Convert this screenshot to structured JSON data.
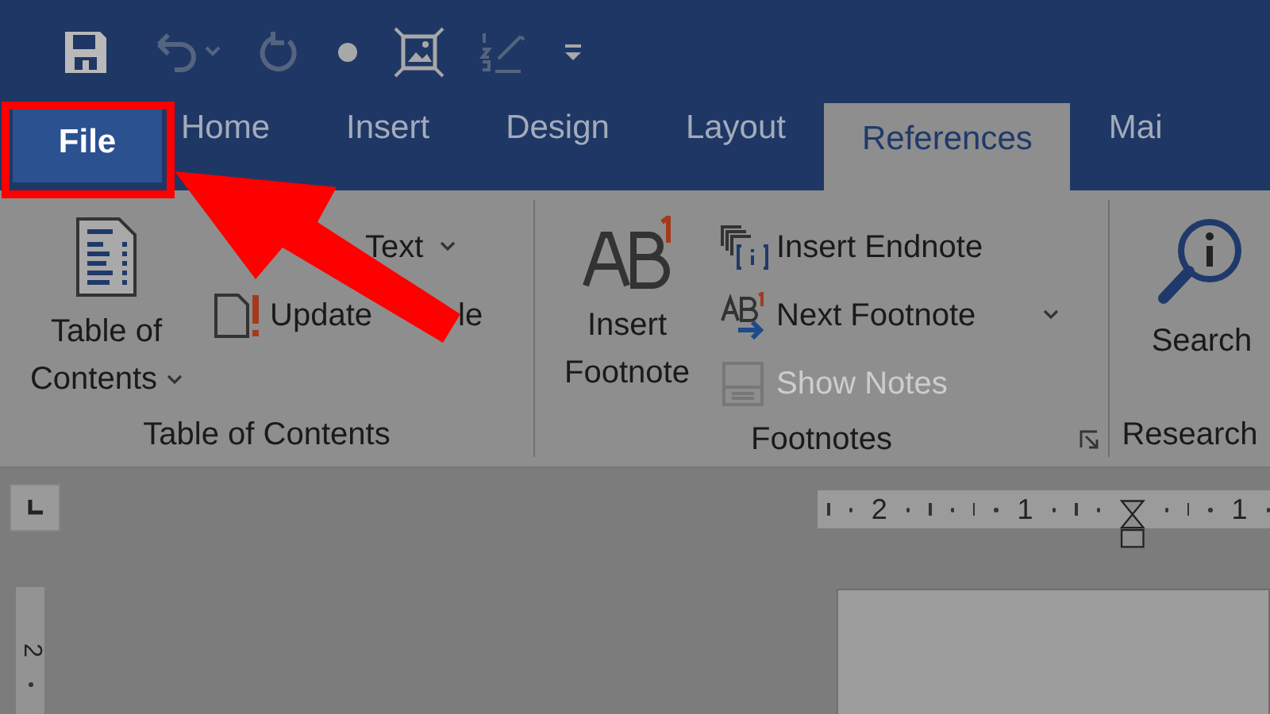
{
  "tabs": [
    {
      "label": "File",
      "selected": false,
      "kind": "backstage"
    },
    {
      "label": "Home",
      "selected": false,
      "kind": "tab"
    },
    {
      "label": "Insert",
      "selected": false,
      "kind": "tab"
    },
    {
      "label": "Design",
      "selected": false,
      "kind": "tab"
    },
    {
      "label": "Layout",
      "selected": false,
      "kind": "tab"
    },
    {
      "label": "References",
      "selected": true,
      "kind": "tab"
    },
    {
      "label": "Mai",
      "selected": false,
      "kind": "tab"
    }
  ],
  "ribbon": {
    "groups": [
      {
        "label": "Table of Contents",
        "launcher": false,
        "items": [
          {
            "kind": "large",
            "label": "Table of Contents",
            "dropdown": true,
            "disabled": false
          },
          {
            "kind": "small",
            "label": "Text",
            "dropdown": true,
            "disabled": false
          },
          {
            "kind": "small",
            "label": "Update",
            "label_tail": "le",
            "dropdown": false,
            "disabled": false
          }
        ]
      },
      {
        "label": "Footnotes",
        "launcher": true,
        "items": [
          {
            "kind": "large",
            "label": "Insert Footnote",
            "dropdown": false,
            "disabled": false
          },
          {
            "kind": "small",
            "label": "Insert Endnote",
            "dropdown": false,
            "disabled": false
          },
          {
            "kind": "small",
            "label": "Next Footnote",
            "dropdown": true,
            "disabled": false
          },
          {
            "kind": "small",
            "label": "Show Notes",
            "dropdown": false,
            "disabled": true
          }
        ]
      },
      {
        "label": "Research",
        "launcher": false,
        "items": [
          {
            "kind": "large",
            "label": "Search",
            "dropdown": false,
            "disabled": false
          }
        ]
      }
    ]
  },
  "ruler": {
    "labels": [
      "2",
      "1",
      "1"
    ]
  },
  "vertical_ruler": {
    "labels": [
      "2"
    ]
  }
}
